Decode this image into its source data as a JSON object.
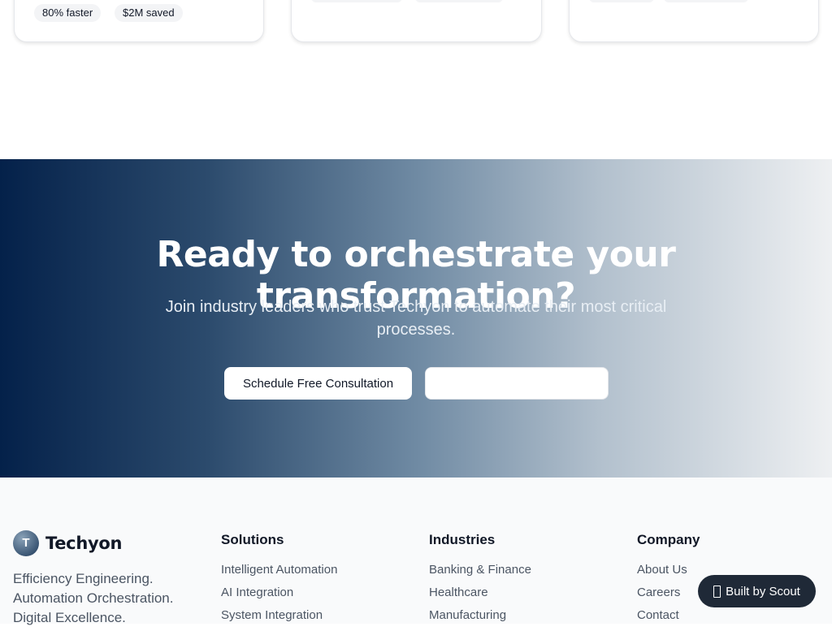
{
  "cards": [
    {
      "pills": [
        "80% faster",
        "$2M saved"
      ]
    },
    {
      "pills": []
    },
    {
      "pills": []
    }
  ],
  "cta": {
    "heading": "Ready to orchestrate your transformation?",
    "subtext": "Join industry leaders who trust Techyon to automate their most critical processes.",
    "primary_button": "Schedule Free Consultation",
    "secondary_button": ""
  },
  "footer": {
    "logo_letter": "T",
    "brand": "Techyon",
    "tagline": [
      "Efficiency Engineering.",
      "Automation Orchestration.",
      "Digital Excellence."
    ],
    "solutions": {
      "title": "Solutions",
      "links": [
        "Intelligent Automation",
        "AI Integration",
        "System Integration"
      ]
    },
    "industries": {
      "title": "Industries",
      "links": [
        "Banking & Finance",
        "Healthcare",
        "Manufacturing"
      ]
    },
    "company": {
      "title": "Company",
      "links": [
        "About Us",
        "Careers",
        "Contact"
      ]
    }
  },
  "badge": {
    "label": "Built by Scout",
    "icon": "device-icon"
  },
  "colors": {
    "cta_gradient_start": "#04214a",
    "cta_gradient_end": "#eef0f2",
    "badge_bg": "#1f2937",
    "footer_bg": "#f9fafb"
  }
}
